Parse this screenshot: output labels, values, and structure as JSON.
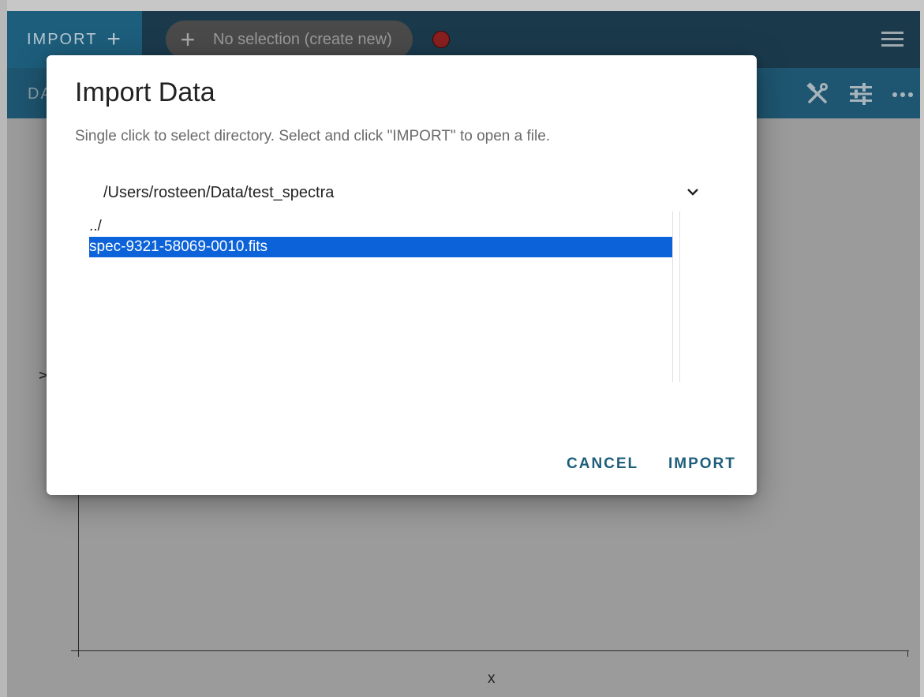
{
  "toolbar": {
    "import_label": "IMPORT",
    "import_icon": "plus-icon",
    "selection_label": "No selection (create new)",
    "selection_icon": "plus-icon",
    "status_color": "#8a1f1f",
    "menu_icon": "hamburger-menu-icon"
  },
  "toolbar2": {
    "data_tab_label": "DA",
    "icons": [
      "tools-icon",
      "sliders-icon",
      "more-horiz-icon"
    ]
  },
  "plot": {
    "ylabel": "y",
    "xlabel": "x"
  },
  "dialog": {
    "title": "Import Data",
    "subtitle": "Single click to select directory. Select and click \"IMPORT\" to open a file.",
    "path": "/Users/rosteen/Data/test_spectra",
    "files": [
      {
        "name": "../",
        "selected": false
      },
      {
        "name": "spec-9321-58069-0010.fits",
        "selected": true
      }
    ],
    "cancel_label": "CANCEL",
    "import_label": "IMPORT"
  },
  "colors": {
    "toolbar_dark": "#1a3a4c",
    "toolbar_light": "#1e5570",
    "accent": "#1e5e7c",
    "selection": "#0b62d9"
  }
}
